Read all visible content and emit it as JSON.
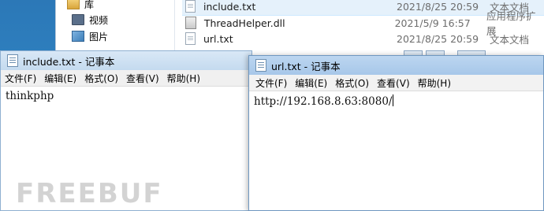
{
  "explorer": {
    "nav_items": [
      {
        "label": "库",
        "icon": "library-icon"
      },
      {
        "label": "视频",
        "icon": "video-icon"
      },
      {
        "label": "图片",
        "icon": "picture-icon"
      }
    ],
    "files": [
      {
        "name": "include.txt",
        "date": "2021/8/25 20:59",
        "type": "文本文档",
        "icon": "text-file-icon",
        "selected": true
      },
      {
        "name": "ThreadHelper.dll",
        "date": "2021/5/9 16:57",
        "type": "应用程序扩展",
        "icon": "dll-file-icon"
      },
      {
        "name": "url.txt",
        "date": "2021/8/25 20:59",
        "type": "文本文档",
        "icon": "text-file-icon"
      }
    ]
  },
  "notepad_left": {
    "title": "include.txt - 记事本",
    "menu": [
      "文件(F)",
      "编辑(E)",
      "格式(O)",
      "查看(V)",
      "帮助(H)"
    ],
    "content": "thinkphp"
  },
  "notepad_right": {
    "title": "url.txt - 记事本",
    "menu": [
      "文件(F)",
      "编辑(E)",
      "格式(O)",
      "查看(V)",
      "帮助(H)"
    ],
    "content": "http://192.168.8.63:8080/"
  },
  "watermark": "FREEBUF"
}
